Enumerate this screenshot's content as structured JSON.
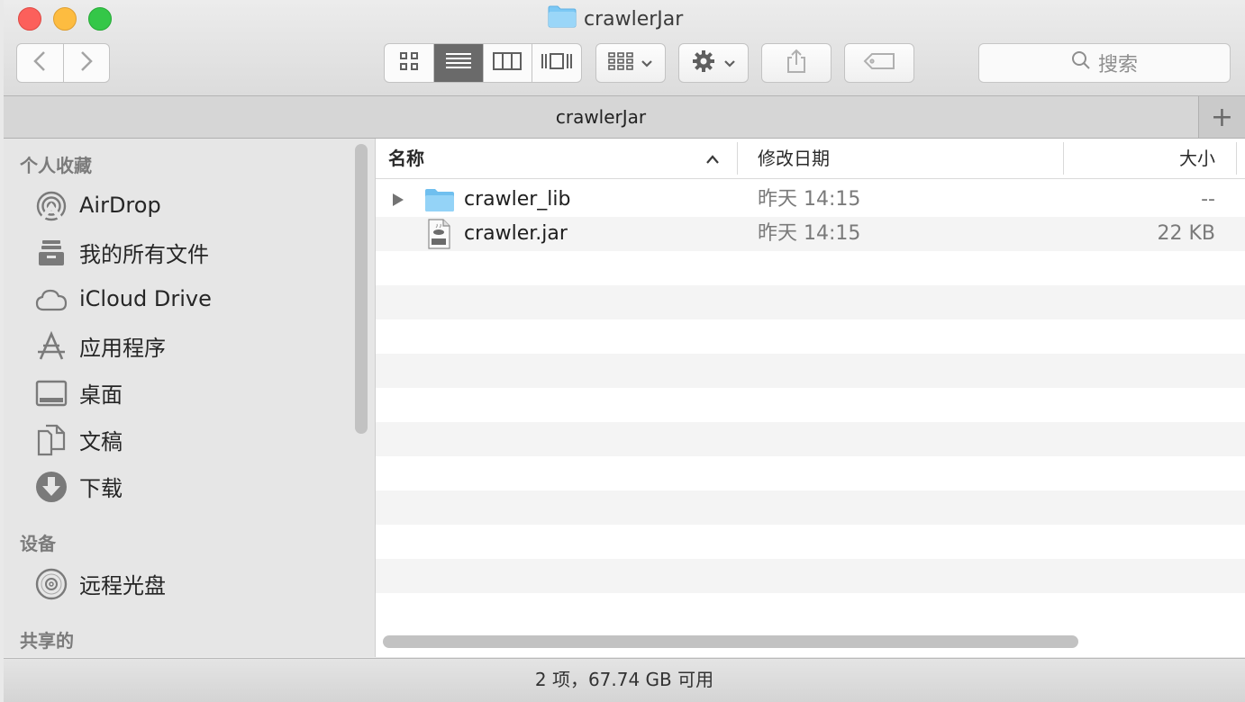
{
  "window": {
    "title": "crawlerJar"
  },
  "toolbar": {
    "view_modes": [
      "icon-view",
      "list-view",
      "column-view",
      "cover-flow-view"
    ],
    "active_view": "list-view",
    "search_placeholder": "搜索"
  },
  "tab": {
    "title": "crawlerJar",
    "add_label": "+"
  },
  "sidebar": {
    "favorites_title": "个人收藏",
    "favorites": [
      {
        "label": "AirDrop",
        "icon": "airdrop-icon"
      },
      {
        "label": "我的所有文件",
        "icon": "all-files-icon"
      },
      {
        "label": "iCloud Drive",
        "icon": "cloud-icon"
      },
      {
        "label": "应用程序",
        "icon": "applications-icon"
      },
      {
        "label": "桌面",
        "icon": "desktop-icon"
      },
      {
        "label": "文稿",
        "icon": "documents-icon"
      },
      {
        "label": "下载",
        "icon": "downloads-icon"
      }
    ],
    "devices_title": "设备",
    "devices": [
      {
        "label": "远程光盘",
        "icon": "disc-icon"
      }
    ],
    "shared_title": "共享的"
  },
  "list": {
    "columns": {
      "name": "名称",
      "modified": "修改日期",
      "size": "大小"
    },
    "rows": [
      {
        "name": "crawler_lib",
        "modified": "昨天 14:15",
        "size": "--",
        "kind": "folder"
      },
      {
        "name": "crawler.jar",
        "modified": "昨天 14:15",
        "size": "22 KB",
        "kind": "jar"
      }
    ]
  },
  "status": {
    "text": "2 项，67.74 GB 可用"
  },
  "colors": {
    "folder": "#7cc8f4",
    "selected_view": "#6a6a6a"
  }
}
